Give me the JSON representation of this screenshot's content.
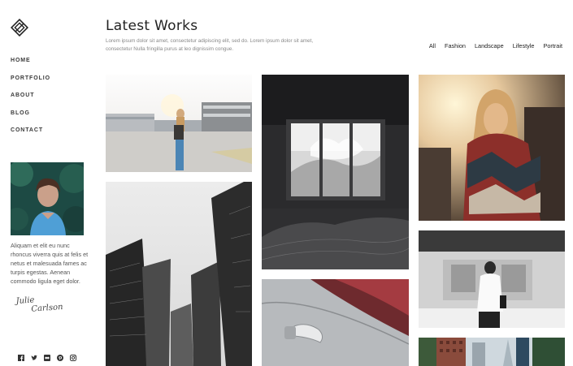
{
  "sidebar": {
    "nav": [
      "Home",
      "Portfolio",
      "About",
      "Blog",
      "Contact"
    ],
    "bio": "Aliquam et elit eu nunc rhoncus viverra quis at felis et netus et malesuada fames ac turpis egestas. Aenean commodo ligula eget dolor.",
    "signature_line1": "Julie",
    "signature_line2": "Carlson",
    "socials": [
      "facebook-icon",
      "twitter-icon",
      "flickr-icon",
      "pinterest-icon",
      "instagram-icon"
    ]
  },
  "header": {
    "title": "Latest Works",
    "intro": "Lorem ipsum dolor sit amet, consectetur adipiscing elit, sed do. Lorem ipsum dolor sit amet, consectetur Nulla fringilla purus at leo dignissim congue."
  },
  "filters": [
    "All",
    "Fashion",
    "Landscape",
    "Lifestyle",
    "Portrait"
  ],
  "gallery": [
    "parking-lot-photo",
    "skyscrapers-photo",
    "bedroom-window-photo",
    "car-door-photo",
    "woman-in-blanket-photo",
    "subway-train-photo",
    "city-buildings-photo"
  ]
}
